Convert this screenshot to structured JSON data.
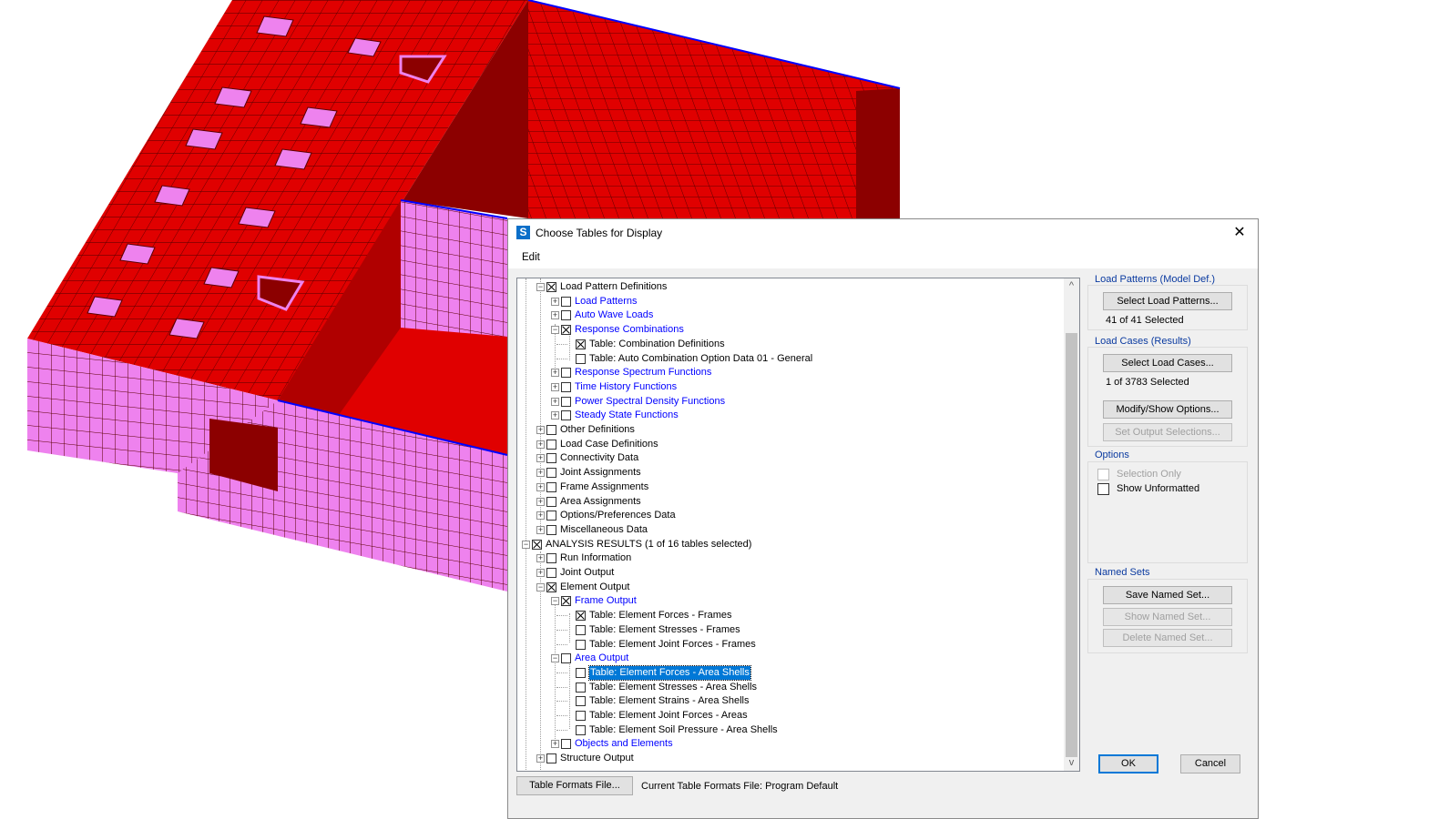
{
  "dialog": {
    "app_icon": "S",
    "title": "Choose Tables for Display",
    "close_glyph": "✕",
    "menu": [
      "Edit"
    ]
  },
  "tree": [
    {
      "level": 2,
      "expander": "minus",
      "check": true,
      "label": "Load Pattern Definitions",
      "blue": false
    },
    {
      "level": 3,
      "expander": "plus",
      "check": false,
      "label": "Load Patterns",
      "blue": true
    },
    {
      "level": 3,
      "expander": "plus",
      "check": false,
      "label": "Auto Wave Loads",
      "blue": true
    },
    {
      "level": 3,
      "expander": "minus",
      "check": true,
      "label": "Response Combinations",
      "blue": true
    },
    {
      "level": 4,
      "expander": null,
      "check": true,
      "label": "Table:  Combination Definitions",
      "blue": false
    },
    {
      "level": 4,
      "expander": null,
      "check": false,
      "label": "Table:  Auto Combination Option Data 01 - General",
      "blue": false
    },
    {
      "level": 3,
      "expander": "plus",
      "check": false,
      "label": "Response Spectrum Functions",
      "blue": true
    },
    {
      "level": 3,
      "expander": "plus",
      "check": false,
      "label": "Time History Functions",
      "blue": true
    },
    {
      "level": 3,
      "expander": "plus",
      "check": false,
      "label": "Power Spectral Density Functions",
      "blue": true
    },
    {
      "level": 3,
      "expander": "plus",
      "check": false,
      "label": "Steady State Functions",
      "blue": true
    },
    {
      "level": 2,
      "expander": "plus",
      "check": false,
      "label": "Other Definitions",
      "blue": false
    },
    {
      "level": 2,
      "expander": "plus",
      "check": false,
      "label": "Load Case Definitions",
      "blue": false
    },
    {
      "level": 2,
      "expander": "plus",
      "check": false,
      "label": "Connectivity Data",
      "blue": false
    },
    {
      "level": 2,
      "expander": "plus",
      "check": false,
      "label": "Joint Assignments",
      "blue": false
    },
    {
      "level": 2,
      "expander": "plus",
      "check": false,
      "label": "Frame Assignments",
      "blue": false
    },
    {
      "level": 2,
      "expander": "plus",
      "check": false,
      "label": "Area Assignments",
      "blue": false
    },
    {
      "level": 2,
      "expander": "plus",
      "check": false,
      "label": "Options/Preferences Data",
      "blue": false
    },
    {
      "level": 2,
      "expander": "plus",
      "check": false,
      "label": "Miscellaneous Data",
      "blue": false
    },
    {
      "level": 1,
      "expander": "minus",
      "check": true,
      "label": "ANALYSIS RESULTS  (1 of 16 tables selected)",
      "blue": false
    },
    {
      "level": 2,
      "expander": "plus",
      "check": false,
      "label": "Run Information",
      "blue": false
    },
    {
      "level": 2,
      "expander": "plus",
      "check": false,
      "label": "Joint Output",
      "blue": false
    },
    {
      "level": 2,
      "expander": "minus",
      "check": true,
      "label": "Element Output",
      "blue": false
    },
    {
      "level": 3,
      "expander": "minus",
      "check": true,
      "label": "Frame Output",
      "blue": true
    },
    {
      "level": 4,
      "expander": null,
      "check": true,
      "label": "Table:  Element Forces - Frames",
      "blue": false
    },
    {
      "level": 4,
      "expander": null,
      "check": false,
      "label": "Table:  Element Stresses - Frames",
      "blue": false
    },
    {
      "level": 4,
      "expander": null,
      "check": false,
      "label": "Table:  Element Joint Forces - Frames",
      "blue": false
    },
    {
      "level": 3,
      "expander": "minus",
      "check": false,
      "label": "Area Output",
      "blue": true
    },
    {
      "level": 4,
      "expander": null,
      "check": false,
      "label": "Table:  Element Forces - Area Shells",
      "blue": false,
      "selected": true
    },
    {
      "level": 4,
      "expander": null,
      "check": false,
      "label": "Table:  Element Stresses - Area Shells",
      "blue": false
    },
    {
      "level": 4,
      "expander": null,
      "check": false,
      "label": "Table:  Element Strains - Area Shells",
      "blue": false
    },
    {
      "level": 4,
      "expander": null,
      "check": false,
      "label": "Table:  Element Joint Forces - Areas",
      "blue": false
    },
    {
      "level": 4,
      "expander": null,
      "check": false,
      "label": "Table:  Element Soil Pressure - Area Shells",
      "blue": false
    },
    {
      "level": 3,
      "expander": "plus",
      "check": false,
      "label": "Objects and Elements",
      "blue": true
    },
    {
      "level": 2,
      "expander": "plus",
      "check": false,
      "label": "Structure Output",
      "blue": false
    }
  ],
  "load_patterns": {
    "title": "Load Patterns (Model Def.)",
    "button": "Select Load Patterns...",
    "status": "41 of 41 Selected"
  },
  "load_cases": {
    "title": "Load Cases (Results)",
    "button": "Select Load Cases...",
    "status": "1 of 3783 Selected",
    "modify_button": "Modify/Show Options...",
    "output_button": "Set Output Selections..."
  },
  "options": {
    "title": "Options",
    "selection_only": "Selection Only",
    "show_unformatted": "Show Unformatted"
  },
  "named_sets": {
    "title": "Named Sets",
    "save": "Save Named Set...",
    "show": "Show Named Set...",
    "delete": "Delete Named Set..."
  },
  "footer": {
    "formats_button": "Table Formats File...",
    "current_label": "Current Table Formats File:  Program Default",
    "ok": "OK",
    "cancel": "Cancel"
  },
  "scroll": {
    "up": "^",
    "down": "v"
  },
  "colors": {
    "roof_red": "#e00000",
    "wall_red": "#b00000",
    "dark_red": "#8c0000",
    "wall_pink": "#ee82ee",
    "mesh_line": "#5a0000",
    "edge_blue": "#0000ff",
    "tree_link": "#0000ff",
    "selection": "#0078d7"
  }
}
